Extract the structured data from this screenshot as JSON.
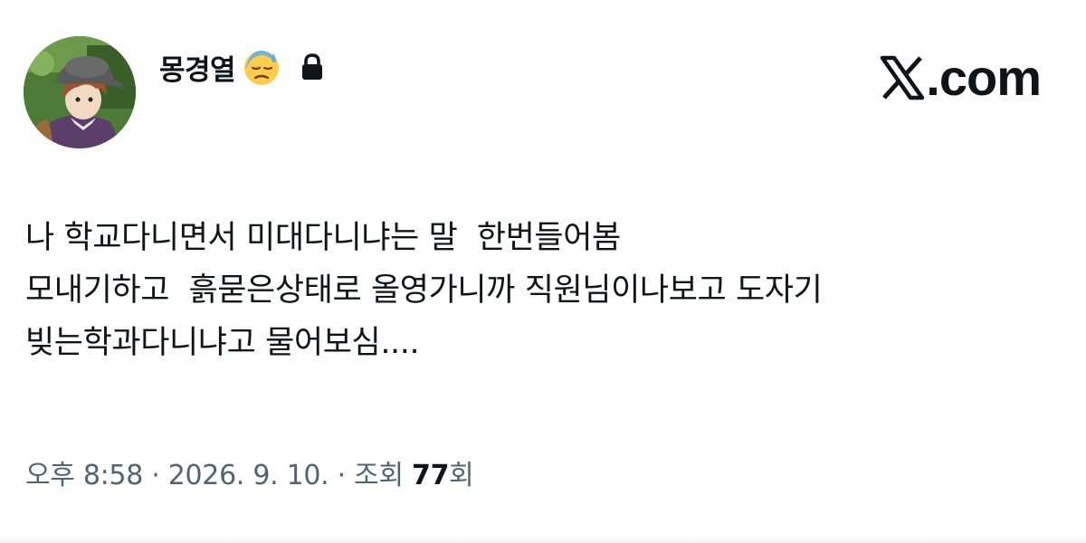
{
  "author": {
    "display_name": "몽경열",
    "status_emoji": "downcast-face-with-sweat-emoji",
    "protected_icon": "lock-icon"
  },
  "brand": {
    "logo_icon": "x-logo-icon",
    "text": ".com"
  },
  "tweet": {
    "lines": [
      "나 학교다니면서 미대다니냐는 말  한번들어봄",
      "모내기하고  흙묻은상태로 올영가니까 직원님이나보고 도자기",
      "빚는학과다니냐고 물어보심...."
    ]
  },
  "meta": {
    "time": "오후 8:58",
    "separator": " · ",
    "date": "2026. 9. 10.",
    "views_label": "조회 ",
    "views_count": "77",
    "views_suffix": "회"
  },
  "colors": {
    "text_primary": "#0f1419",
    "text_secondary": "#536471",
    "background": "#ffffff"
  }
}
